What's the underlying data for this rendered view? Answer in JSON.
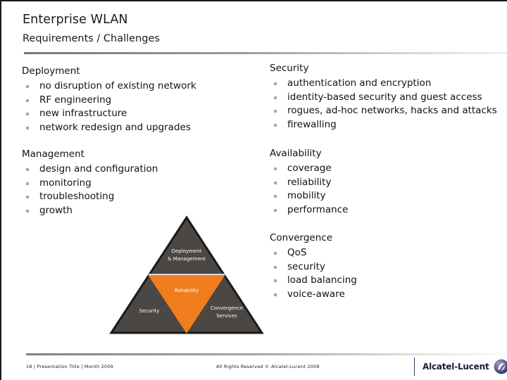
{
  "slide": {
    "title": "Enterprise WLAN",
    "subtitle": "Requirements / Challenges",
    "left_column": [
      {
        "heading": "Deployment",
        "items": [
          "no disruption of existing network",
          "RF engineering",
          "new infrastructure",
          "network redesign and upgrades"
        ]
      },
      {
        "heading": "Management",
        "items": [
          "design and configuration",
          "monitoring",
          "troubleshooting",
          "growth"
        ]
      }
    ],
    "right_column": [
      {
        "heading": "Security",
        "items": [
          "authentication and encryption",
          "identity-based security and guest access",
          "rogues, ad-hoc networks, hacks and attacks",
          "firewalling"
        ]
      },
      {
        "heading": "Availability",
        "items": [
          "coverage",
          "reliability",
          "mobility",
          "performance"
        ]
      },
      {
        "heading": "Convergence",
        "items": [
          "QoS",
          "security",
          "load balancing",
          "voice-aware"
        ]
      }
    ],
    "diagram": {
      "name": "wlan-pyramid",
      "top_label_line1": "Deployment",
      "top_label_line2": "& Management",
      "center_label": "Reliability",
      "bottom_left_label": "Security",
      "bottom_right_label_line1": "Convergence",
      "bottom_right_label_line2": "Services",
      "outer_color": "#4a4744",
      "inner_color": "#f07d1e",
      "outline_color": "#1a1a1a"
    },
    "footer": {
      "left": "18 | Presentation Title | Month 2009",
      "center": "All Rights Reserved © Alcatel-Lucent 2009",
      "logo_text": "Alcatel-Lucent",
      "logo_color": "#6b5f96"
    }
  }
}
